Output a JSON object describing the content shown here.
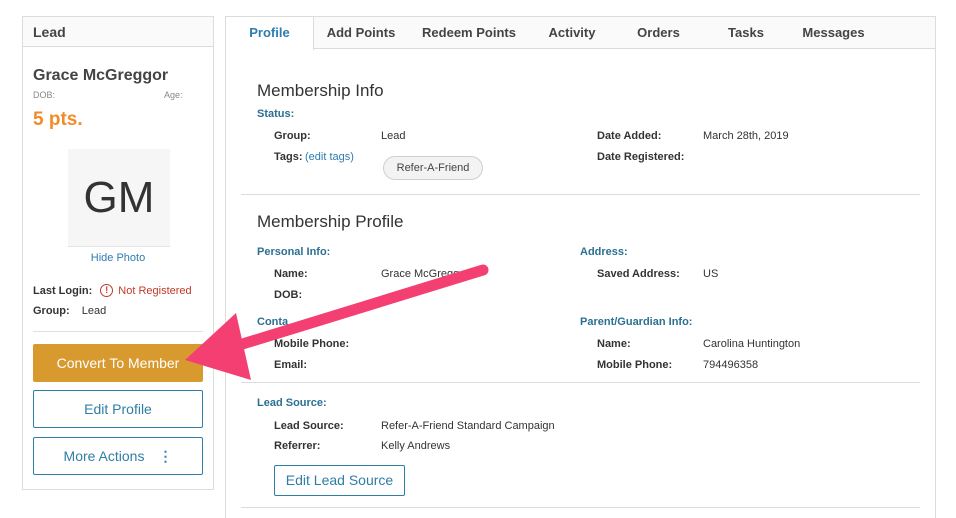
{
  "left": {
    "header": "Lead",
    "name": "Grace McGreggor",
    "dob_label": "DOB:",
    "age_label": "Age:",
    "points": "5 pts.",
    "initials": "GM",
    "hide_photo": "Hide Photo",
    "last_login_label": "Last Login:",
    "last_login_value": "Not Registered",
    "group_label": "Group:",
    "group_value": "Lead",
    "convert_button": "Convert To Member",
    "edit_button": "Edit Profile",
    "more_button": "More Actions"
  },
  "tabs": [
    "Profile",
    "Add Points",
    "Redeem Points",
    "Activity",
    "Orders",
    "Tasks",
    "Messages"
  ],
  "membership_info": {
    "title": "Membership Info",
    "status_label": "Status:",
    "group_key": "Group:",
    "group_val": "Lead",
    "tags_key": "Tags:",
    "edit_tags": "(edit tags)",
    "tag_pill": "Refer-A-Friend",
    "date_added_key": "Date Added:",
    "date_added_val": "March 28th, 2019",
    "date_registered_key": "Date Registered:"
  },
  "membership_profile": {
    "title": "Membership Profile",
    "personal_label": "Personal Info:",
    "name_key": "Name:",
    "name_val": "Grace McGreggor",
    "dob_key": "DOB:",
    "contact_label": "Conta",
    "mobile_key": "Mobile Phone:",
    "email_key": "Email:",
    "address_label": "Address:",
    "saved_address_key": "Saved Address:",
    "saved_address_val": "US",
    "parent_label": "Parent/Guardian Info:",
    "parent_name_key": "Name:",
    "parent_name_val": "Carolina Huntington",
    "parent_mobile_key": "Mobile Phone:",
    "parent_mobile_val": "794496358"
  },
  "lead_source": {
    "label": "Lead Source:",
    "source_key": "Lead Source:",
    "source_val": "Refer-A-Friend Standard Campaign",
    "referrer_key": "Referrer:",
    "referrer_val": "Kelly Andrews",
    "edit_button": "Edit Lead Source"
  },
  "colors": {
    "accent_blue": "#2e7cb0",
    "points_orange": "#f28c28",
    "convert_gold": "#d89a2f",
    "annotation_pink": "#f43f73",
    "error_red": "#c0392b"
  },
  "icons": {
    "warning": "exclamation-circle-icon",
    "more": "vertical-dots-icon",
    "annotation": "pink-arrow-icon"
  }
}
